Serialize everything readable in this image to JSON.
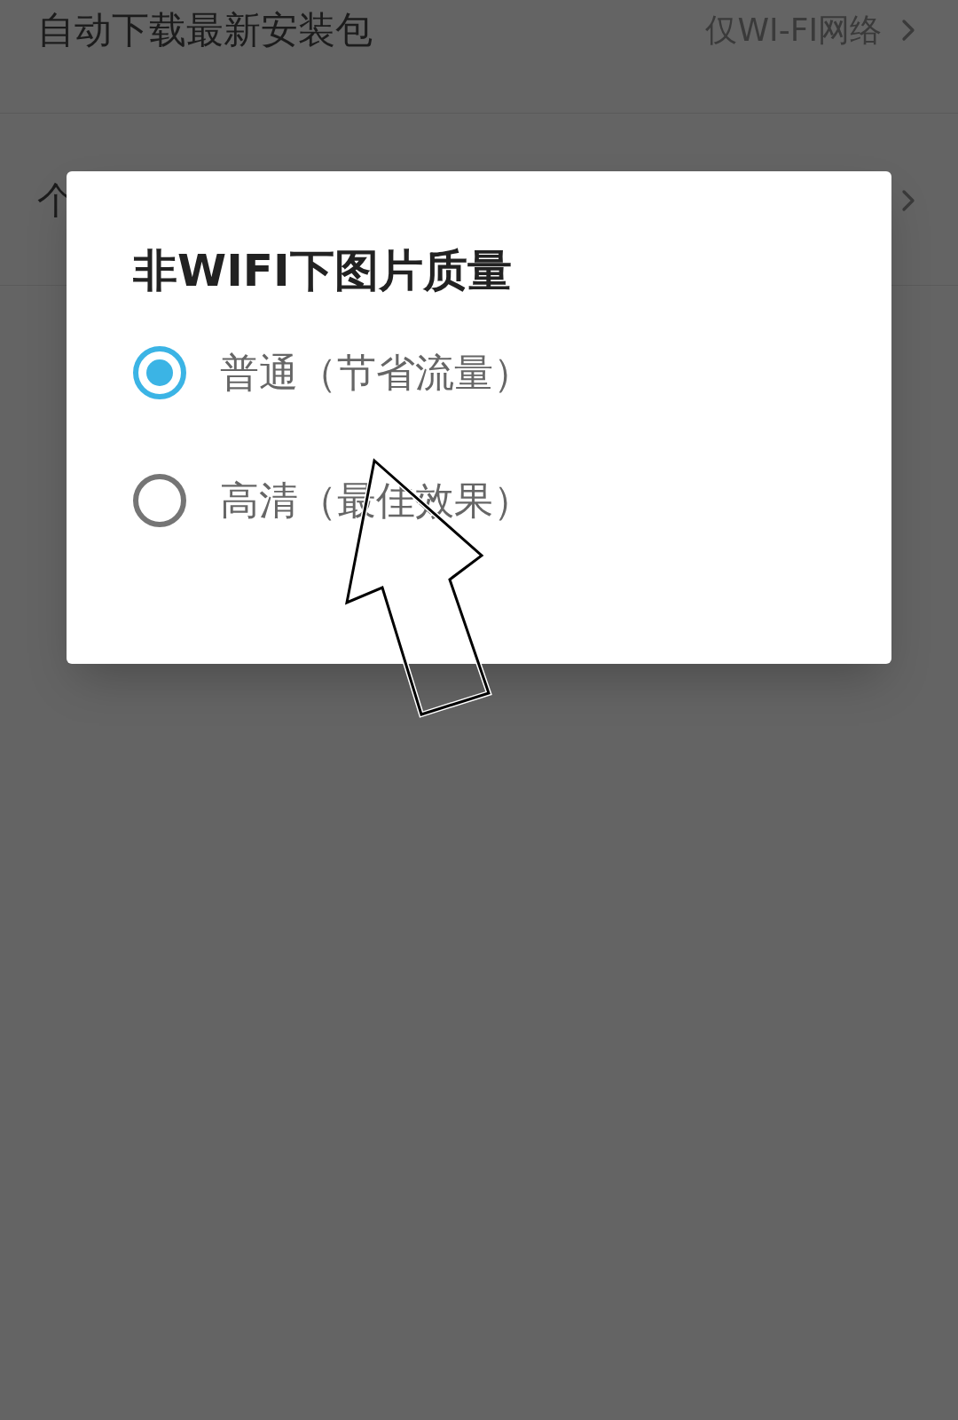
{
  "settings": [
    {
      "label": "自动下载最新安装包",
      "value": "仅WI-FI网络"
    },
    {
      "label": "个"
    }
  ],
  "dialog": {
    "title": "非WIFI下图片质量",
    "options": [
      {
        "label": "普通（节省流量）",
        "selected": true
      },
      {
        "label": "高清（最佳效果）",
        "selected": false
      }
    ]
  }
}
